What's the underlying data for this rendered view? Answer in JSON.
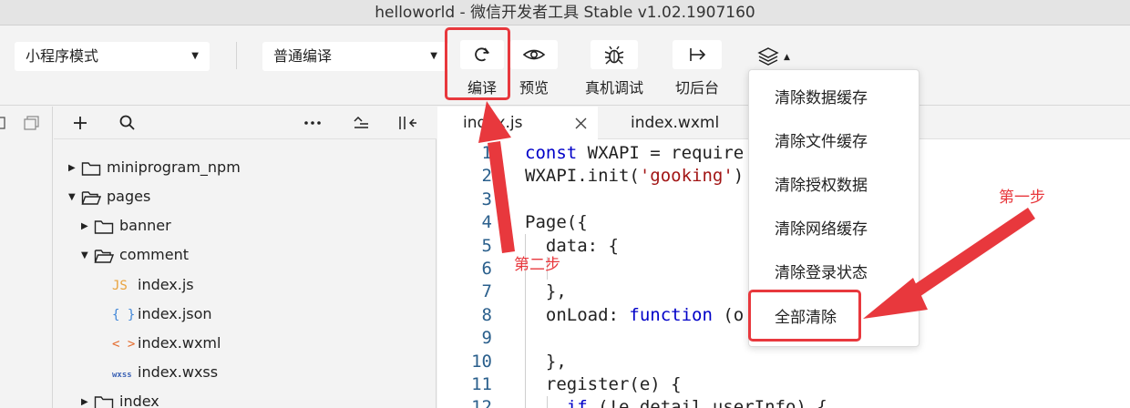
{
  "window": {
    "title": "helloworld - 微信开发者工具 Stable v1.02.1907160"
  },
  "toolbar": {
    "mode_select": "小程序模式",
    "compile_select": "普通编译",
    "buttons": [
      {
        "label": "编译",
        "icon": "refresh-icon"
      },
      {
        "label": "预览",
        "icon": "eye-icon"
      },
      {
        "label": "真机调试",
        "icon": "bug-icon"
      },
      {
        "label": "切后台",
        "icon": "exit-arrow-icon"
      }
    ],
    "layers_icon": "layers-icon"
  },
  "explorer": {
    "tree": [
      {
        "label": "miniprogram_npm",
        "type": "folder",
        "expanded": false
      },
      {
        "label": "pages",
        "type": "folder",
        "expanded": true
      },
      {
        "label": "banner",
        "type": "folder",
        "expanded": false
      },
      {
        "label": "comment",
        "type": "folder",
        "expanded": true
      },
      {
        "label": "index.js",
        "type": "file",
        "badge": "JS"
      },
      {
        "label": "index.json",
        "type": "file",
        "badge": "{ }"
      },
      {
        "label": "index.wxml",
        "type": "file",
        "badge": "< >"
      },
      {
        "label": "index.wxss",
        "type": "file",
        "badge": "wxss"
      },
      {
        "label": "index",
        "type": "folder",
        "expanded": false
      }
    ]
  },
  "tabs": [
    {
      "label": "index.js",
      "active": true
    },
    {
      "label": "index.wxml",
      "active": false
    }
  ],
  "editor": {
    "line_numbers": [
      "1",
      "2",
      "3",
      "4",
      "5",
      "6",
      "7",
      "8",
      "9",
      "10",
      "11",
      "12"
    ],
    "lines": [
      [
        [
          "kw",
          "const"
        ],
        [
          "",
          " WXAPI = require"
        ]
      ],
      [
        [
          "",
          "WXAPI.init("
        ],
        [
          "str",
          "'gooking'"
        ],
        [
          "",
          ")"
        ]
      ],
      [],
      [
        [
          "",
          "Page({"
        ]
      ],
      [
        [
          "",
          "  data: {"
        ]
      ],
      [],
      [
        [
          "",
          "  },"
        ]
      ],
      [
        [
          "",
          "  onLoad: "
        ],
        [
          "kw",
          "function"
        ],
        [
          "",
          " (o"
        ]
      ],
      [],
      [
        [
          "",
          "  },"
        ]
      ],
      [
        [
          "",
          "  register(e) {"
        ]
      ],
      [
        [
          "",
          "    "
        ],
        [
          "kw",
          "if"
        ],
        [
          "",
          " (!e.detail.userInfo) {"
        ]
      ]
    ]
  },
  "cache_menu": {
    "items": [
      "清除数据缓存",
      "清除文件缓存",
      "清除授权数据",
      "清除网络缓存",
      "清除登录状态",
      "全部清除"
    ]
  },
  "annotations": {
    "step1": "第一步",
    "step2": "第二步",
    "color": "#e8383d"
  }
}
